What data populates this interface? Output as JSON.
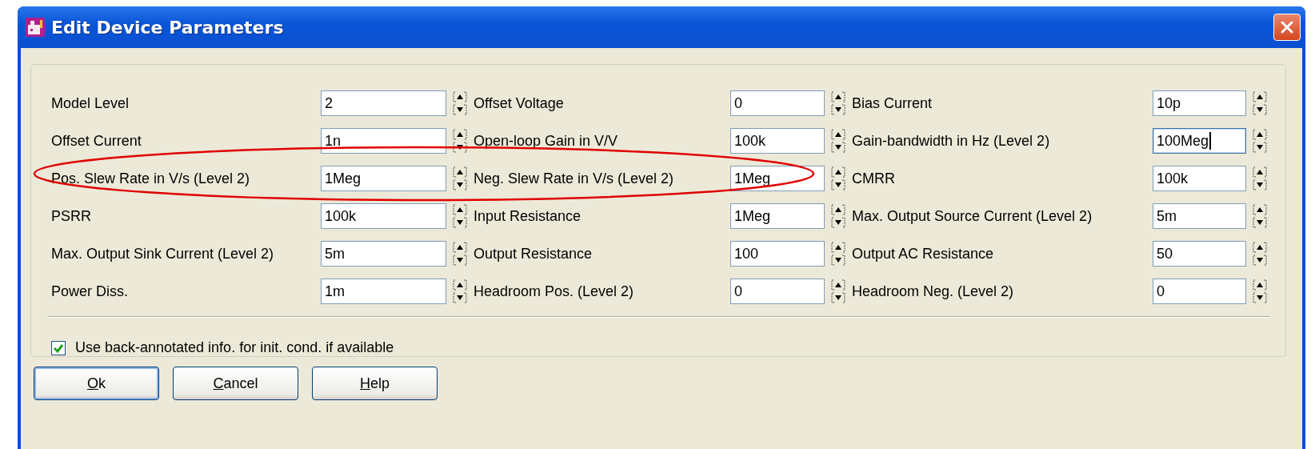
{
  "window": {
    "title": "Edit Device Parameters"
  },
  "parameters": [
    {
      "label": "Model Level",
      "value": "2",
      "focused": false
    },
    {
      "label": "Offset Voltage",
      "value": "0",
      "focused": false
    },
    {
      "label": "Bias Current",
      "value": "10p",
      "focused": false
    },
    {
      "label": "Offset Current",
      "value": "1n",
      "focused": false
    },
    {
      "label": "Open-loop Gain in V/V",
      "value": "100k",
      "focused": false
    },
    {
      "label": "Gain-bandwidth in Hz (Level 2)",
      "value": "100Meg",
      "focused": true
    },
    {
      "label": "Pos. Slew Rate in V/s (Level 2)",
      "value": "1Meg",
      "focused": false
    },
    {
      "label": "Neg. Slew Rate in V/s (Level 2)",
      "value": "1Meg",
      "focused": false
    },
    {
      "label": "CMRR",
      "value": "100k",
      "focused": false
    },
    {
      "label": "PSRR",
      "value": "100k",
      "focused": false
    },
    {
      "label": "Input Resistance",
      "value": "1Meg",
      "focused": false
    },
    {
      "label": "Max. Output Source Current (Level 2)",
      "value": "5m",
      "focused": false
    },
    {
      "label": "Max. Output Sink Current (Level 2)",
      "value": "5m",
      "focused": false
    },
    {
      "label": "Output Resistance",
      "value": "100",
      "focused": false
    },
    {
      "label": "Output AC Resistance",
      "value": "50",
      "focused": false
    },
    {
      "label": "Power Diss.",
      "value": "1m",
      "focused": false
    },
    {
      "label": "Headroom Pos. (Level 2)",
      "value": "0",
      "focused": false
    },
    {
      "label": "Headroom Neg. (Level 2)",
      "value": "0",
      "focused": false
    }
  ],
  "option": {
    "label": "Use back-annotated info. for init. cond. if available",
    "checked": true
  },
  "buttons": [
    {
      "label": "Ok",
      "default": true,
      "underline_first": true
    },
    {
      "label": "Cancel",
      "default": false,
      "underline_first": true
    },
    {
      "label": "Help",
      "default": false,
      "underline_first": true
    }
  ],
  "annotation": {
    "kind": "ellipse",
    "color": "#e00000"
  }
}
